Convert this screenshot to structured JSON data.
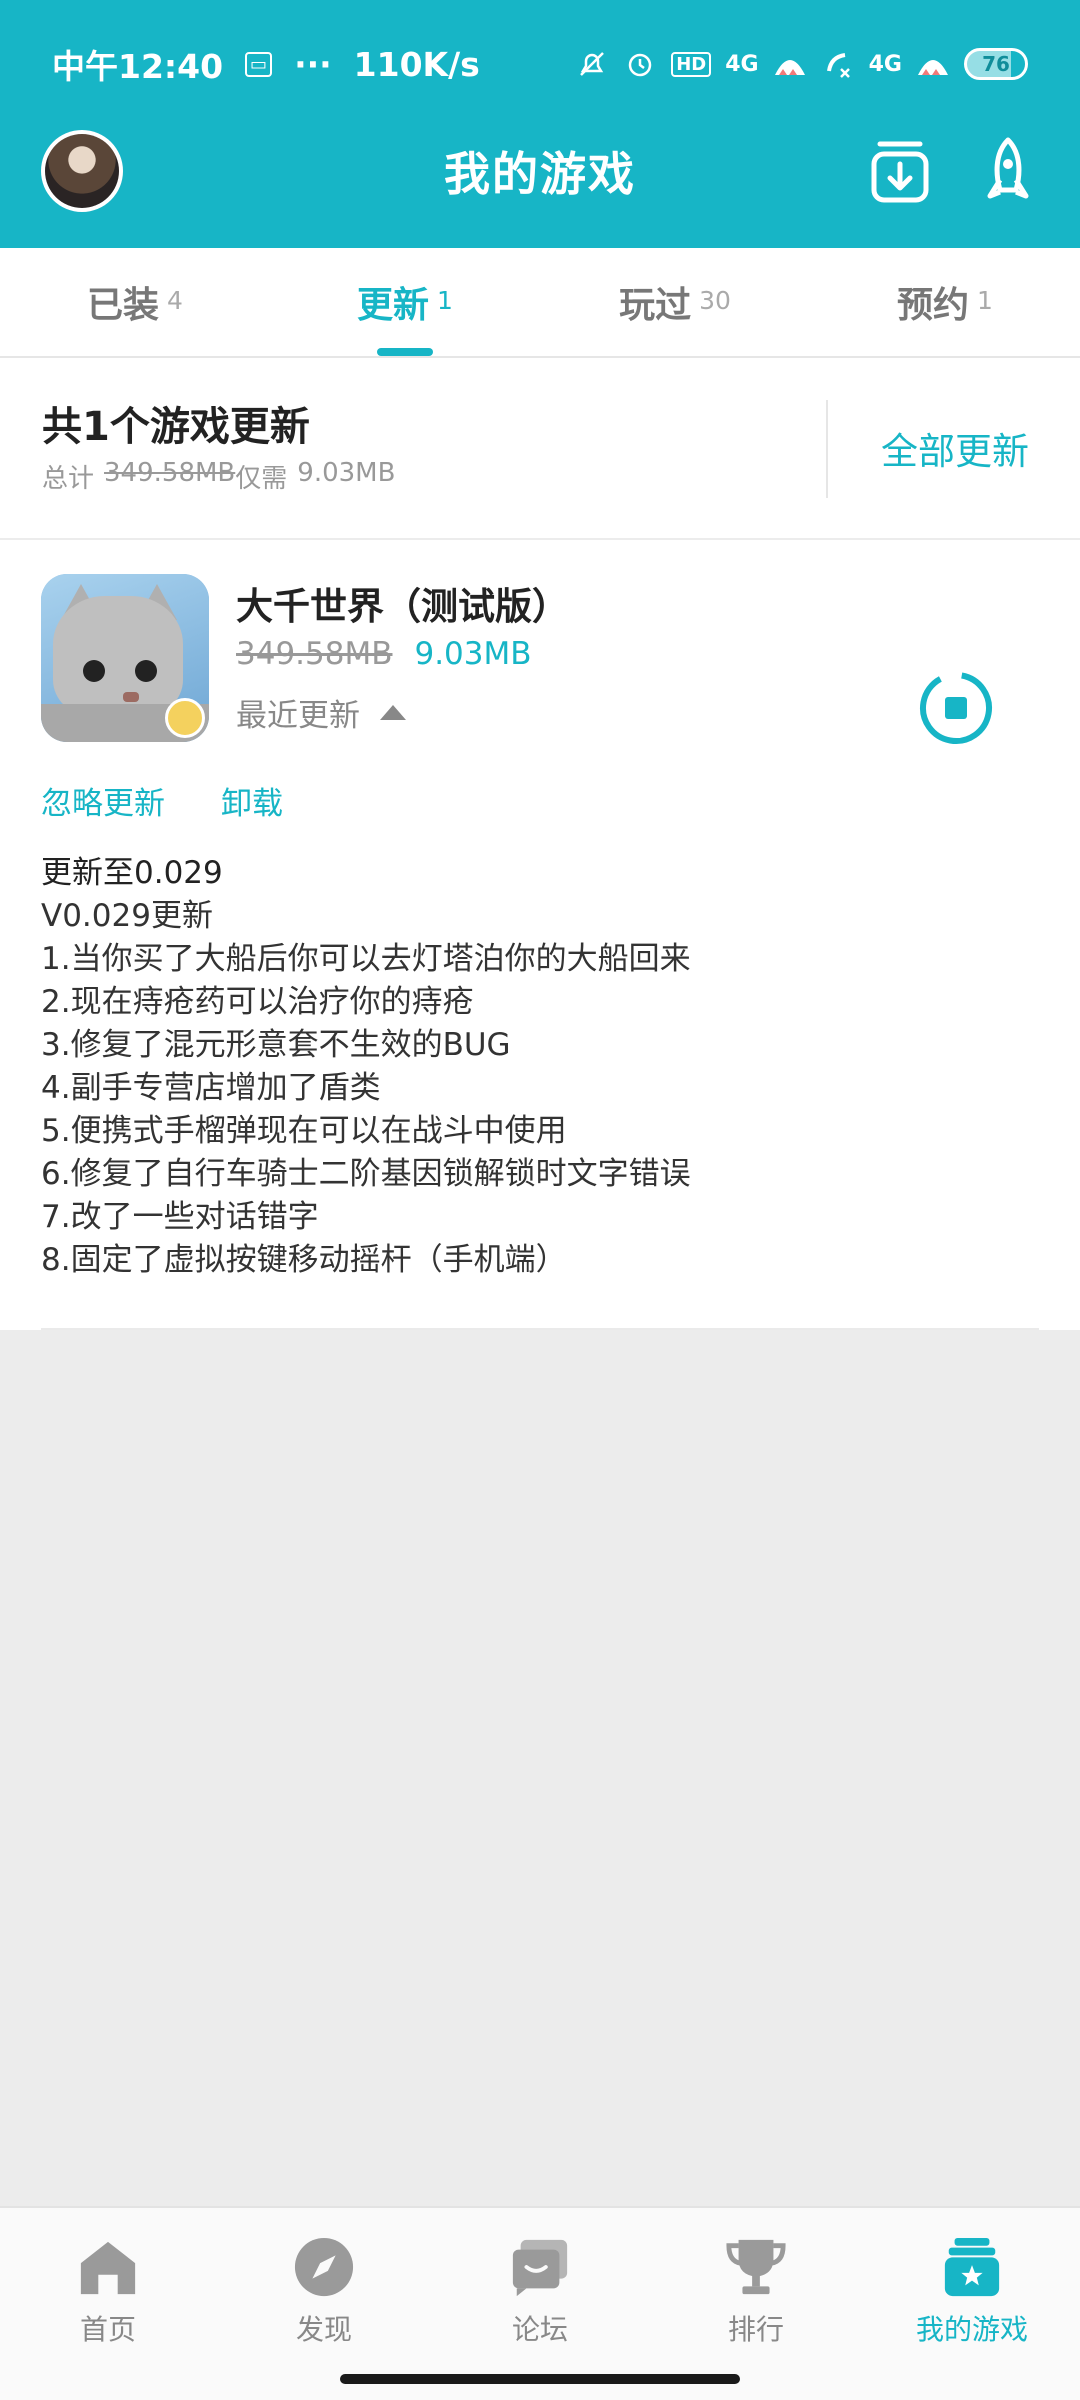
{
  "status_bar": {
    "time": "中午12:40",
    "dots": "···",
    "speed": "110K/s",
    "network_1": "4G",
    "network_2": "4G",
    "hd": "HD",
    "battery": "76"
  },
  "app_bar": {
    "title": "我的游戏"
  },
  "tabs": [
    {
      "label": "已装",
      "count": "4"
    },
    {
      "label": "更新",
      "count": "1"
    },
    {
      "label": "玩过",
      "count": "30"
    },
    {
      "label": "预约",
      "count": "1"
    }
  ],
  "summary": {
    "title": "共1个游戏更新",
    "total_label": "总计",
    "original_size": "349.58MB",
    "only_need_label": "仅需",
    "patch_size": "9.03MB",
    "update_all": "全部更新"
  },
  "game": {
    "name": "大千世界（测试版）",
    "original_size": "349.58MB",
    "patch_size": "9.03MB",
    "recent_update": "最近更新",
    "ignore_update": "忽略更新",
    "uninstall": "卸载",
    "notes": [
      "更新至0.029",
      "V0.029更新",
      "1.当你买了大船后你可以去灯塔泊你的大船回来",
      "2.现在痔疮药可以治疗你的痔疮",
      "3.修复了混元形意套不生效的BUG",
      "4.副手专营店增加了盾类",
      "5.便携式手榴弹现在可以在战斗中使用",
      "6.修复了自行车骑士二阶基因锁解锁时文字错误",
      "7.改了一些对话错字",
      "8.固定了虚拟按键移动摇杆（手机端）"
    ]
  },
  "bottom_nav": [
    {
      "label": "首页",
      "icon": "home-icon"
    },
    {
      "label": "发现",
      "icon": "compass-icon"
    },
    {
      "label": "论坛",
      "icon": "forum-icon"
    },
    {
      "label": "排行",
      "icon": "trophy-icon"
    },
    {
      "label": "我的游戏",
      "icon": "my-games-icon"
    }
  ],
  "colors": {
    "accent": "#17b5c6",
    "background": "#ececec"
  }
}
